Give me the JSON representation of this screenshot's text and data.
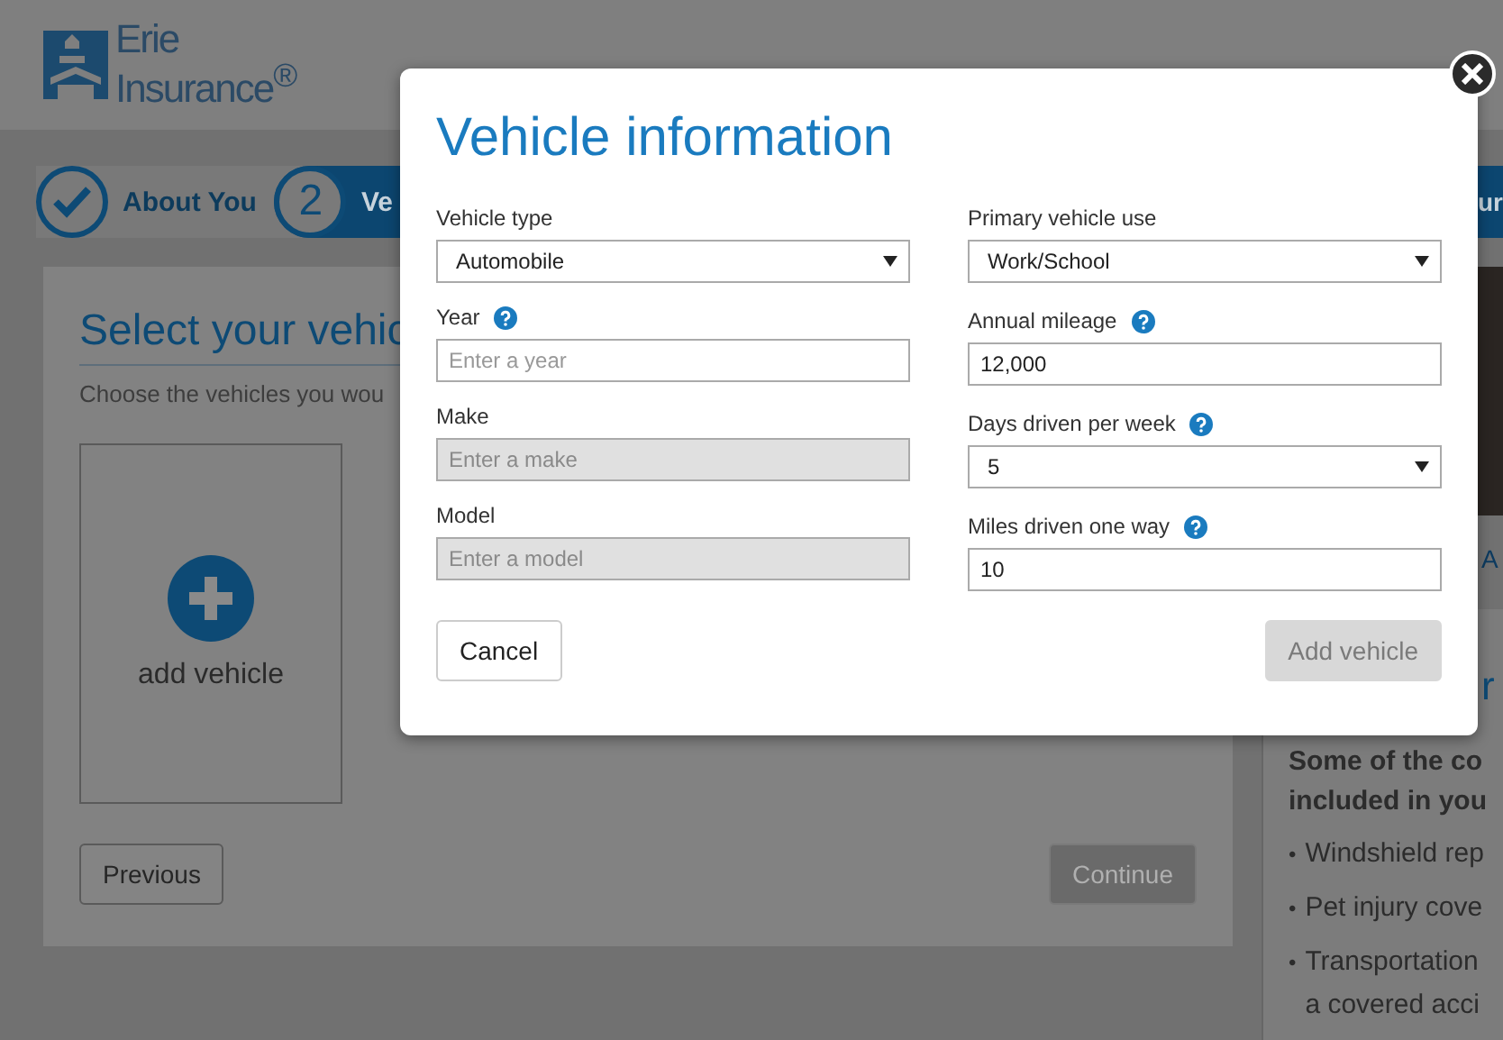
{
  "header": {
    "logo_line1": "Erie",
    "logo_line2": "Insurance$^{®}$"
  },
  "progress": [
    {
      "kind": "done",
      "label": "About You"
    },
    {
      "kind": "current",
      "number": "2",
      "label": "Ve"
    },
    {
      "kind": "current",
      "label": "ur"
    }
  ],
  "main": {
    "heading": "Select your vehic",
    "subtext": "Choose the vehicles you wou",
    "add_card": "add vehicle",
    "buttons": [
      {
        "label": "Previous",
        "disabled": false
      },
      {
        "label": "Continue",
        "disabled": true
      }
    ]
  },
  "sidebar": {
    "link": "A",
    "heading": "r",
    "intro": [
      "Some of the co",
      "included in you"
    ],
    "bullets": [
      {
        "marker": "•",
        "lines": [
          "Windshield rep"
        ]
      },
      {
        "marker": "•",
        "lines": [
          "Pet injury cove"
        ]
      },
      {
        "marker": "•",
        "lines": [
          "Transportation",
          "a covered acci"
        ]
      }
    ]
  },
  "modal": {
    "title": "Vehicle information",
    "columns": [
      [
        {
          "kind": "select",
          "label": "Vehicle type",
          "help": false,
          "value": "Automobile",
          "disabled": false
        },
        {
          "kind": "text",
          "label": "Year",
          "help": true,
          "placeholder": "Enter a year",
          "disabled": false
        },
        {
          "kind": "text",
          "label": "Make",
          "help": false,
          "placeholder": "Enter a make",
          "disabled": true
        },
        {
          "kind": "text",
          "label": "Model",
          "help": false,
          "placeholder": "Enter a model",
          "disabled": true
        }
      ],
      [
        {
          "kind": "select",
          "label": "Primary vehicle use",
          "help": false,
          "value": "Work/School",
          "disabled": false
        },
        {
          "kind": "text",
          "label": "Annual mileage",
          "help": true,
          "value": "12,000",
          "disabled": false
        },
        {
          "kind": "select",
          "label": "Days driven per week",
          "help": true,
          "value": "5",
          "disabled": false
        },
        {
          "kind": "text",
          "label": "Miles driven one way",
          "help": true,
          "value": "10",
          "disabled": false
        }
      ]
    ],
    "cancel": {
      "label": "Cancel",
      "disabled": false
    },
    "submit": {
      "label": "Add vehicle",
      "disabled": true
    }
  }
}
